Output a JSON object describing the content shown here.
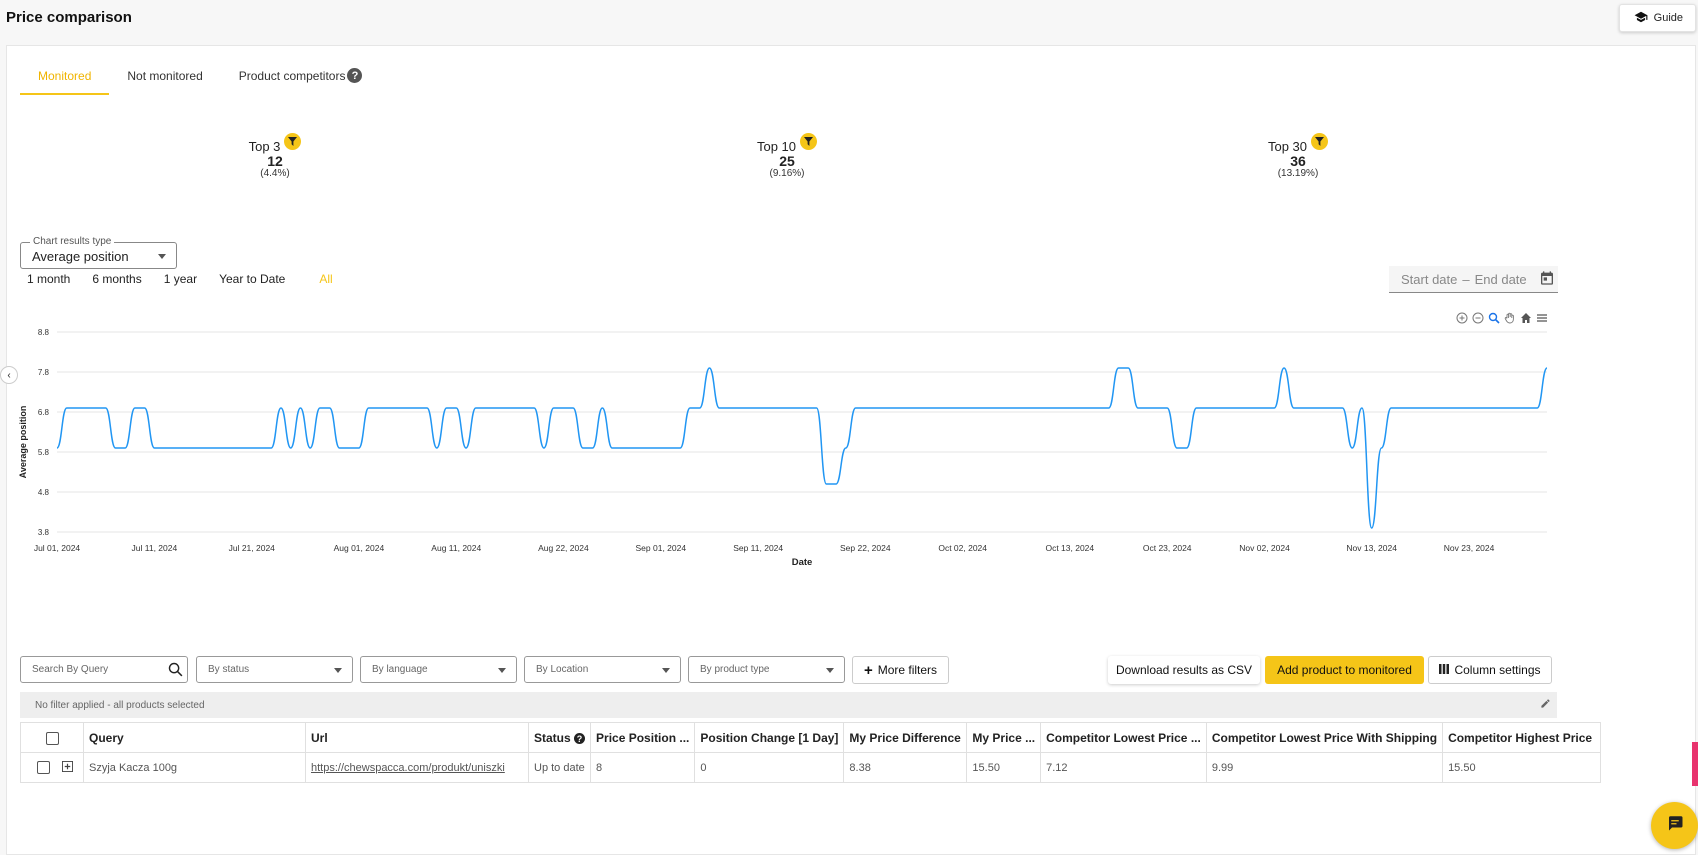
{
  "page": {
    "title": "Price comparison",
    "guide_label": "Guide"
  },
  "tabs": [
    {
      "label": "Monitored",
      "active": true
    },
    {
      "label": "Not monitored",
      "active": false
    },
    {
      "label": "Product competitors",
      "active": false
    }
  ],
  "stats": [
    {
      "label": "Top 3",
      "value": "12",
      "pct": "(4.4%)"
    },
    {
      "label": "Top 10",
      "value": "25",
      "pct": "(9.16%)"
    },
    {
      "label": "Top 30",
      "value": "36",
      "pct": "(13.19%)"
    }
  ],
  "chart_type_select": {
    "legend": "Chart results type",
    "value": "Average position"
  },
  "ranges": [
    "1 month",
    "6 months",
    "1 year",
    "Year to Date",
    "All"
  ],
  "active_range": "All",
  "daterange": {
    "start_placeholder": "Start date",
    "separator": "–",
    "end_placeholder": "End date"
  },
  "chart_data": {
    "type": "line",
    "xlabel": "Date",
    "ylabel": "Average position",
    "ylim": [
      3.8,
      8.8
    ],
    "yticks": [
      "8.8",
      "7.8",
      "6.8",
      "5.8",
      "4.8",
      "3.8"
    ],
    "xticks": [
      "Jul 01, 2024",
      "Jul 11, 2024",
      "Jul 21, 2024",
      "Aug 01, 2024",
      "Aug 11, 2024",
      "Aug 22, 2024",
      "Sep 01, 2024",
      "Sep 11, 2024",
      "Sep 22, 2024",
      "Oct 02, 2024",
      "Oct 13, 2024",
      "Oct 23, 2024",
      "Nov 02, 2024",
      "Nov 13, 2024",
      "Nov 23, 2024"
    ],
    "x_start": "2024-07-01",
    "x_end": "2024-12-01",
    "color": "#2196f3",
    "series": [
      {
        "points": [
          [
            "2024-07-01",
            5.9
          ],
          [
            "2024-07-02",
            6.9
          ],
          [
            "2024-07-05",
            6.9
          ],
          [
            "2024-07-06",
            6.9
          ],
          [
            "2024-07-07",
            5.9
          ],
          [
            "2024-07-08",
            5.9
          ],
          [
            "2024-07-09",
            6.9
          ],
          [
            "2024-07-10",
            6.9
          ],
          [
            "2024-07-11",
            5.9
          ],
          [
            "2024-07-13",
            5.9
          ],
          [
            "2024-07-23",
            5.9
          ],
          [
            "2024-07-24",
            6.9
          ],
          [
            "2024-07-25",
            5.9
          ],
          [
            "2024-07-26",
            6.9
          ],
          [
            "2024-07-27",
            5.9
          ],
          [
            "2024-07-28",
            6.9
          ],
          [
            "2024-07-29",
            6.9
          ],
          [
            "2024-07-30",
            5.9
          ],
          [
            "2024-08-01",
            5.9
          ],
          [
            "2024-08-02",
            6.9
          ],
          [
            "2024-08-08",
            6.9
          ],
          [
            "2024-08-09",
            5.9
          ],
          [
            "2024-08-10",
            6.9
          ],
          [
            "2024-08-11",
            6.9
          ],
          [
            "2024-08-12",
            5.9
          ],
          [
            "2024-08-13",
            6.9
          ],
          [
            "2024-08-19",
            6.9
          ],
          [
            "2024-08-20",
            5.9
          ],
          [
            "2024-08-21",
            6.9
          ],
          [
            "2024-08-23",
            6.9
          ],
          [
            "2024-08-24",
            5.9
          ],
          [
            "2024-08-25",
            5.9
          ],
          [
            "2024-08-26",
            6.9
          ],
          [
            "2024-08-27",
            5.9
          ],
          [
            "2024-09-03",
            5.9
          ],
          [
            "2024-09-04",
            6.9
          ],
          [
            "2024-09-05",
            6.9
          ],
          [
            "2024-09-06",
            7.9
          ],
          [
            "2024-09-07",
            6.9
          ],
          [
            "2024-09-17",
            6.9
          ],
          [
            "2024-09-18",
            5.0
          ],
          [
            "2024-09-19",
            5.0
          ],
          [
            "2024-09-20",
            5.9
          ],
          [
            "2024-09-21",
            6.9
          ],
          [
            "2024-10-17",
            6.9
          ],
          [
            "2024-10-18",
            7.9
          ],
          [
            "2024-10-19",
            7.9
          ],
          [
            "2024-10-20",
            6.9
          ],
          [
            "2024-10-23",
            6.9
          ],
          [
            "2024-10-24",
            5.9
          ],
          [
            "2024-10-25",
            5.9
          ],
          [
            "2024-10-26",
            6.9
          ],
          [
            "2024-11-03",
            6.9
          ],
          [
            "2024-11-04",
            7.9
          ],
          [
            "2024-11-05",
            6.9
          ],
          [
            "2024-11-10",
            6.9
          ],
          [
            "2024-11-11",
            5.9
          ],
          [
            "2024-11-12",
            6.9
          ],
          [
            "2024-11-13",
            3.9
          ],
          [
            "2024-11-14",
            5.9
          ],
          [
            "2024-11-15",
            6.9
          ],
          [
            "2024-11-30",
            6.9
          ],
          [
            "2024-12-01",
            7.9
          ]
        ]
      }
    ]
  },
  "filters": {
    "search_placeholder": "Search By Query",
    "status": "By status",
    "language": "By language",
    "location": "By Location",
    "product_type": "By product type",
    "more_filters": "More filters",
    "download_csv": "Download results as CSV",
    "add_product": "Add product to monitored",
    "column_settings": "Column settings",
    "applied_text": "No filter applied - all products selected"
  },
  "table": {
    "columns": [
      "Query",
      "Url",
      "Status",
      "Price Position ...",
      "Position Change [1 Day]",
      "My Price Difference",
      "My Price ...",
      "Competitor Lowest Price ...",
      "Competitor Lowest Price With Shipping",
      "Competitor Highest Price"
    ],
    "rows": [
      [
        "Szyja Kacza 100g",
        "https://chewspacca.com/produkt/uniszki",
        "Up to date",
        "8",
        "0",
        "8.38",
        "15.50",
        "7.12",
        "9.99",
        "15.50"
      ]
    ]
  },
  "colors": {
    "accent": "#f5c518",
    "line": "#2196f3"
  }
}
